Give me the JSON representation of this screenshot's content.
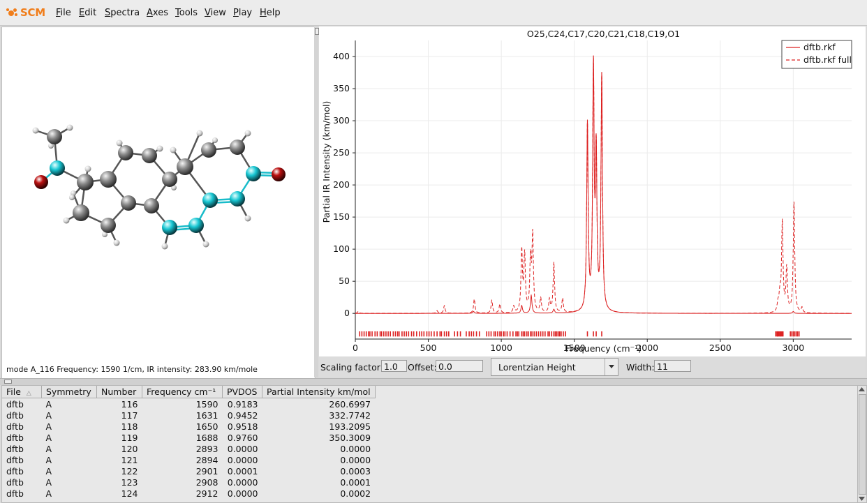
{
  "app": {
    "logo_text": "SCM"
  },
  "menu": [
    {
      "label": "File",
      "u": "F",
      "rest": "ile"
    },
    {
      "label": "Edit",
      "u": "E",
      "rest": "dit"
    },
    {
      "label": "Spectra",
      "u": "S",
      "rest": "pectra"
    },
    {
      "label": "Axes",
      "u": "A",
      "rest": "xes"
    },
    {
      "label": "Tools",
      "u": "T",
      "rest": "ools"
    },
    {
      "label": "View",
      "u": "V",
      "rest": "iew"
    },
    {
      "label": "Play",
      "u": "P",
      "rest": "lay"
    },
    {
      "label": "Help",
      "u": "H",
      "rest": "elp"
    }
  ],
  "molecule": {
    "status": "mode A_116 Frequency: 1590 1/cm, IR intensity: 283.90 km/mole"
  },
  "chart_data": {
    "type": "line",
    "title": "O25,C24,C17,C20,C21,C18,C19,O1",
    "xlabel": "Frequency (cm⁻¹)",
    "ylabel": "Partial IR Intensity (km/mol)",
    "xlim": [
      0,
      3400
    ],
    "ylim": [
      -40,
      425
    ],
    "xticks": [
      0,
      500,
      1000,
      1500,
      2000,
      2500,
      3000
    ],
    "yticks": [
      0,
      50,
      100,
      150,
      200,
      250,
      300,
      350,
      400
    ],
    "grid": true,
    "legend_position": "top-right",
    "series": [
      {
        "name": "dftb.rkf",
        "style": "solid",
        "color": "#dd2222",
        "peaks": [
          [
            810,
            3
          ],
          [
            1140,
            12
          ],
          [
            1205,
            28
          ],
          [
            1360,
            6
          ],
          [
            1590,
            290
          ],
          [
            1631,
            370
          ],
          [
            1650,
            235
          ],
          [
            1688,
            365
          ],
          [
            3000,
            3
          ]
        ]
      },
      {
        "name": "dftb.rkf full",
        "style": "dashed",
        "color": "#dd2222",
        "peaks": [
          [
            20,
            3
          ],
          [
            560,
            4
          ],
          [
            610,
            12
          ],
          [
            815,
            22
          ],
          [
            935,
            20
          ],
          [
            990,
            14
          ],
          [
            1085,
            10
          ],
          [
            1140,
            95
          ],
          [
            1160,
            88
          ],
          [
            1200,
            80
          ],
          [
            1215,
            118
          ],
          [
            1270,
            22
          ],
          [
            1330,
            20
          ],
          [
            1360,
            78
          ],
          [
            1420,
            22
          ],
          [
            1590,
            290
          ],
          [
            1631,
            370
          ],
          [
            1650,
            235
          ],
          [
            1688,
            365
          ],
          [
            2895,
            12
          ],
          [
            2905,
            10
          ],
          [
            2910,
            18
          ],
          [
            2925,
            140
          ],
          [
            2955,
            68
          ],
          [
            3005,
            172
          ],
          [
            3060,
            8
          ]
        ]
      }
    ],
    "stick_frequencies": [
      30,
      45,
      60,
      75,
      90,
      100,
      115,
      135,
      150,
      170,
      180,
      195,
      210,
      225,
      240,
      260,
      275,
      290,
      300,
      320,
      335,
      350,
      365,
      385,
      400,
      420,
      440,
      455,
      470,
      490,
      505,
      520,
      540,
      560,
      580,
      590,
      610,
      625,
      640,
      680,
      700,
      720,
      760,
      780,
      795,
      810,
      830,
      850,
      900,
      915,
      930,
      950,
      960,
      975,
      990,
      1000,
      1015,
      1025,
      1040,
      1060,
      1080,
      1100,
      1110,
      1120,
      1140,
      1150,
      1160,
      1175,
      1185,
      1200,
      1210,
      1225,
      1240,
      1255,
      1270,
      1285,
      1300,
      1320,
      1330,
      1345,
      1360,
      1370,
      1380,
      1390,
      1400,
      1410,
      1425,
      1440,
      1590,
      1631,
      1650,
      1688,
      2880,
      2888,
      2893,
      2894,
      2901,
      2908,
      2912,
      2918,
      2925,
      2930,
      2980,
      2990,
      3000,
      3010,
      3020,
      3030,
      3040
    ]
  },
  "controls": {
    "scaling_label": "Scaling factor:",
    "scaling_value": "1.0",
    "offset_label": "Offset:",
    "offset_value": "0.0",
    "lineshape": "Lorentzian Height",
    "width_label": "Width:",
    "width_value": "11"
  },
  "table": {
    "columns": [
      "File",
      "Symmetry",
      "Number",
      "Frequency cm⁻¹",
      "PVDOS",
      "Partial Intensity km/mol"
    ],
    "rows": [
      [
        "dftb",
        "A",
        "116",
        "1590",
        "0.9183",
        "260.6997"
      ],
      [
        "dftb",
        "A",
        "117",
        "1631",
        "0.9452",
        "332.7742"
      ],
      [
        "dftb",
        "A",
        "118",
        "1650",
        "0.9518",
        "193.2095"
      ],
      [
        "dftb",
        "A",
        "119",
        "1688",
        "0.9760",
        "350.3009"
      ],
      [
        "dftb",
        "A",
        "120",
        "2893",
        "0.0000",
        "0.0000"
      ],
      [
        "dftb",
        "A",
        "121",
        "2894",
        "0.0000",
        "0.0000"
      ],
      [
        "dftb",
        "A",
        "122",
        "2901",
        "0.0001",
        "0.0003"
      ],
      [
        "dftb",
        "A",
        "123",
        "2908",
        "0.0000",
        "0.0001"
      ],
      [
        "dftb",
        "A",
        "124",
        "2912",
        "0.0000",
        "0.0002"
      ]
    ]
  }
}
